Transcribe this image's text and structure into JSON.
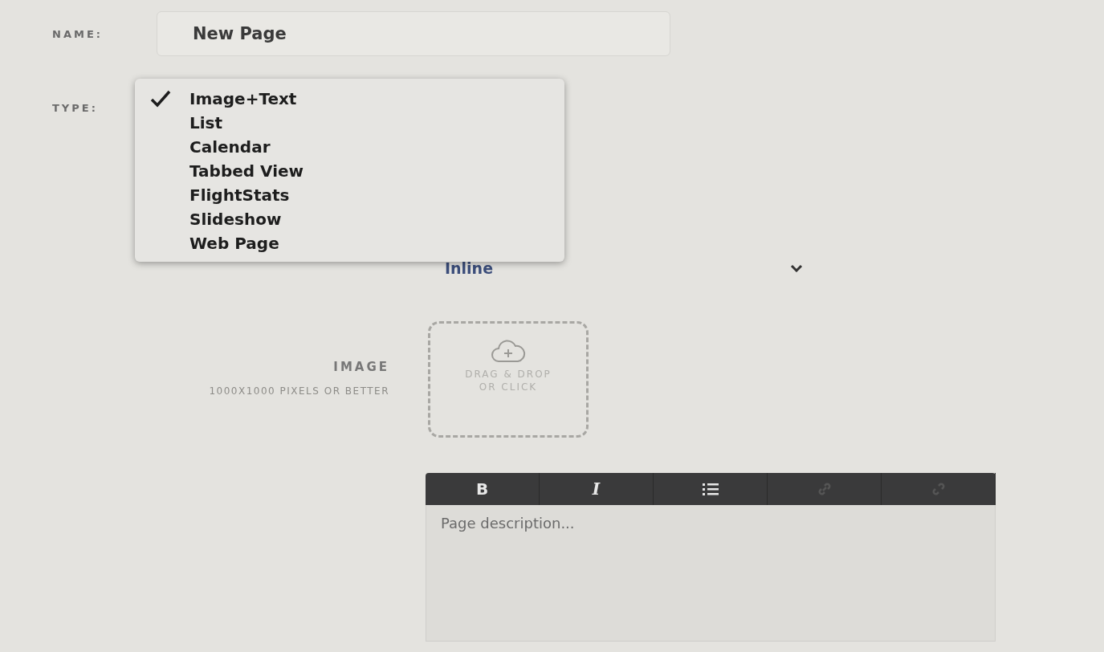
{
  "name_field": {
    "label": "NAME:",
    "value": "New Page"
  },
  "type_field": {
    "label": "TYPE:",
    "options": [
      {
        "label": "Image+Text",
        "selected": true
      },
      {
        "label": "List",
        "selected": false
      },
      {
        "label": "Calendar",
        "selected": false
      },
      {
        "label": "Tabbed View",
        "selected": false
      },
      {
        "label": "FlightStats",
        "selected": false
      },
      {
        "label": "Slideshow",
        "selected": false
      },
      {
        "label": "Web Page",
        "selected": false
      }
    ]
  },
  "layout_field": {
    "value": "Inline"
  },
  "image_field": {
    "label": "IMAGE",
    "hint": "1000X1000 PIXELS OR BETTER",
    "drop_text": "DRAG & DROP OR CLICK"
  },
  "editor": {
    "tools": [
      {
        "kind": "bold",
        "label": "B",
        "disabled": false
      },
      {
        "kind": "italic",
        "label": "I",
        "disabled": false
      },
      {
        "kind": "list",
        "disabled": false
      },
      {
        "kind": "link",
        "disabled": true
      },
      {
        "kind": "unlink",
        "disabled": true
      }
    ],
    "placeholder": "Page description..."
  }
}
